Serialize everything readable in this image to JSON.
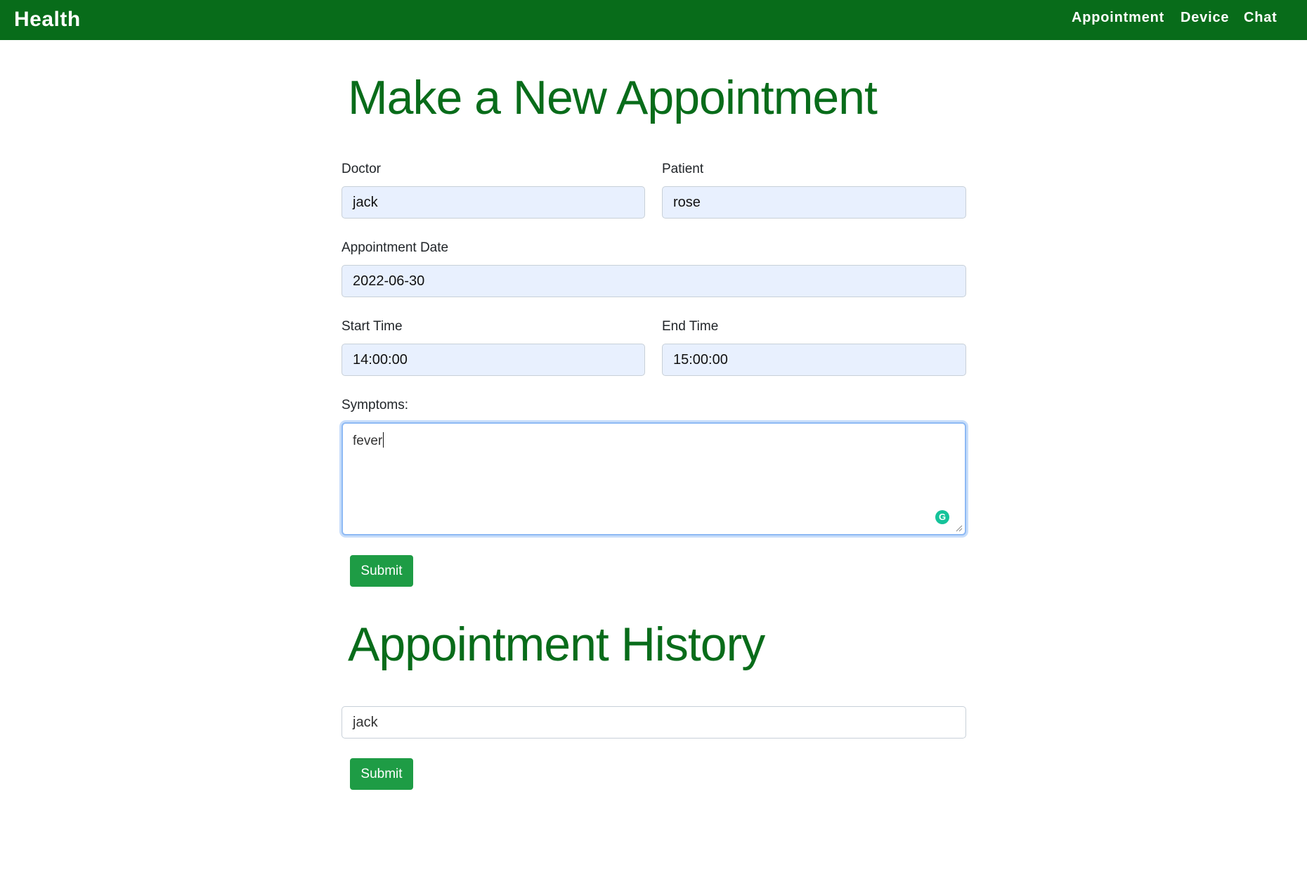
{
  "navbar": {
    "brand": "Health",
    "links": [
      "Appointment",
      "Device",
      "Chat"
    ],
    "color": "#086c1a"
  },
  "new_appointment": {
    "title": "Make a New Appointment",
    "doctor": {
      "label": "Doctor",
      "value": "jack"
    },
    "patient": {
      "label": "Patient",
      "value": "rose"
    },
    "date": {
      "label": "Appointment Date",
      "value": "2022-06-30"
    },
    "start_time": {
      "label": "Start Time",
      "value": "14:00:00"
    },
    "end_time": {
      "label": "End Time",
      "value": "15:00:00"
    },
    "symptoms": {
      "label": "Symptoms:",
      "value": "fever"
    },
    "submit_label": "Submit"
  },
  "history": {
    "title": "Appointment History",
    "search_value": "jack",
    "submit_label": "Submit"
  },
  "colors": {
    "heading": "#086c1a",
    "button": "#1e9c45",
    "autofill_field": "#e8f0fe"
  },
  "icons": {
    "grammarly": "grammarly-icon",
    "resize": "resize-handle-icon"
  }
}
